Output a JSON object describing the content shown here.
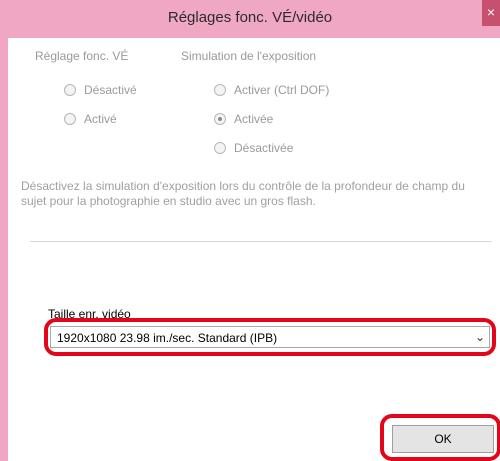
{
  "window": {
    "title": "Réglages fonc. VÉ/vidéo",
    "close_glyph": "×"
  },
  "ve_group": {
    "label": "Réglage fonc. VÉ",
    "options": [
      "Désactivé",
      "Activé"
    ],
    "selected": null
  },
  "exposure_group": {
    "label": "Simulation de l'exposition",
    "options": [
      "Activer (Ctrl DOF)",
      "Activée",
      "Désactivée"
    ],
    "selected": "Activée"
  },
  "description": "Désactivez la simulation d'exposition lors du contrôle de la profondeur de champ du sujet pour la photographie en studio avec un gros flash.",
  "video": {
    "label": "Taille enr. vidéo",
    "selected_value": "1920x1080 23.98 im./sec. Standard (IPB)",
    "dropdown_glyph": "⌄"
  },
  "buttons": {
    "ok_label": "OK"
  },
  "colors": {
    "frame": "#f0a7c4",
    "highlight": "#e3061a"
  }
}
